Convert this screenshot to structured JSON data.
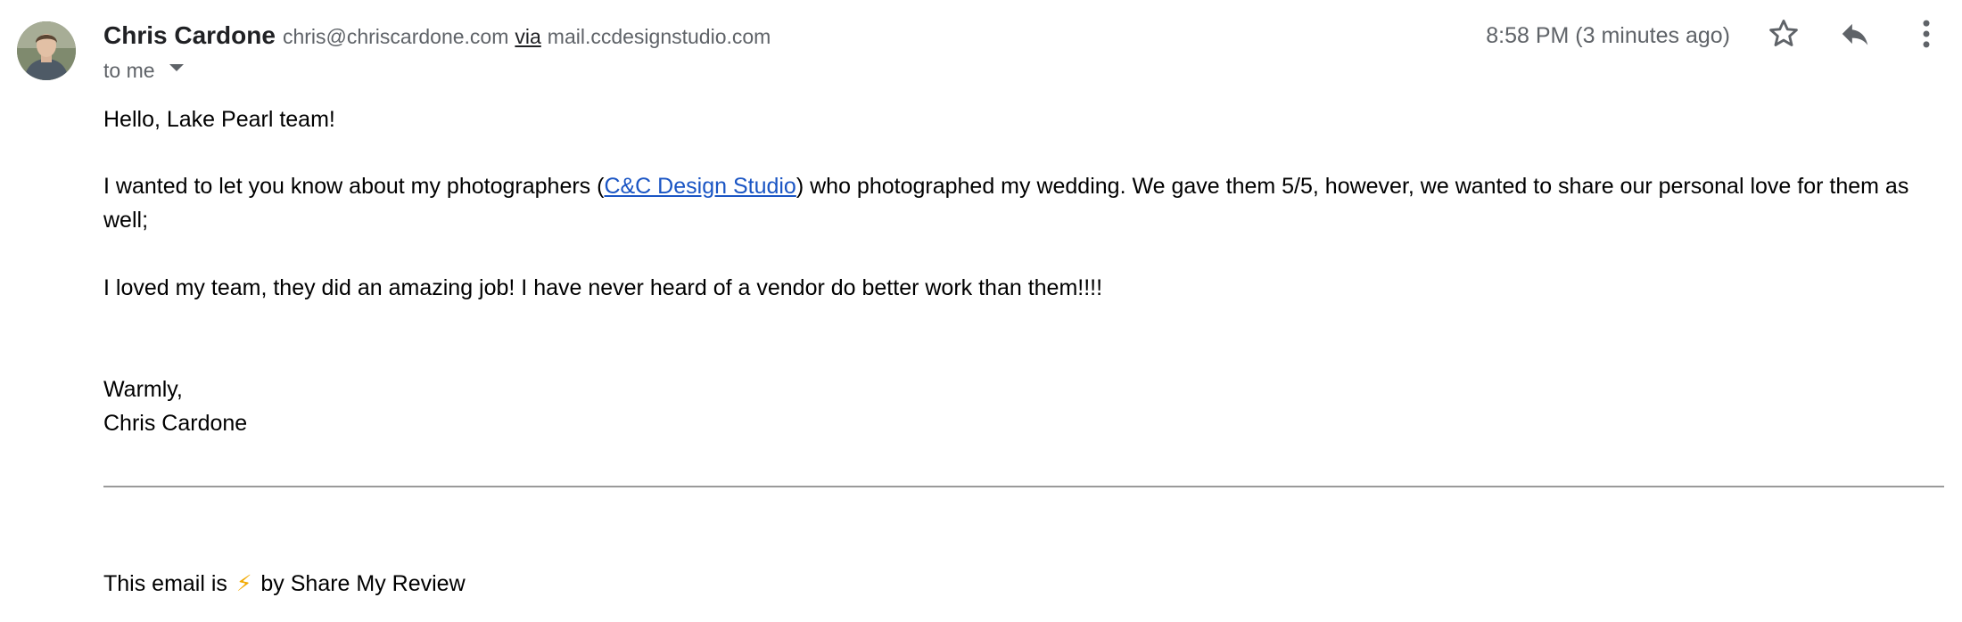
{
  "sender": {
    "name": "Chris Cardone",
    "email": "chris@chriscardone.com",
    "via_label": "via",
    "via_domain": "mail.ccdesignstudio.com"
  },
  "recipient_label": "to me",
  "timestamp": "8:58 PM (3 minutes ago)",
  "icons": {
    "star": "star-outline-icon",
    "reply": "reply-icon",
    "more": "more-vertical-icon"
  },
  "body": {
    "greeting": "Hello, Lake Pearl team!",
    "para1_before": "I wanted to let you know about my photographers (",
    "para1_link": "C&C Design Studio",
    "para1_after": ") who photographed my wedding. We gave them 5/5, however, we wanted to share our personal love for them as well;",
    "para2": "I loved my team, they did an amazing job! I have never heard of a vendor do better work than them!!!!",
    "signoff": "Warmly,",
    "signature": "Chris Cardone"
  },
  "footer": {
    "prefix": "This email is",
    "emoji": "⚡",
    "suffix": "by Share My Review"
  },
  "colors": {
    "link": "#1a55c4",
    "secondary_text": "#5f6368",
    "bolt": "#f2a900"
  }
}
